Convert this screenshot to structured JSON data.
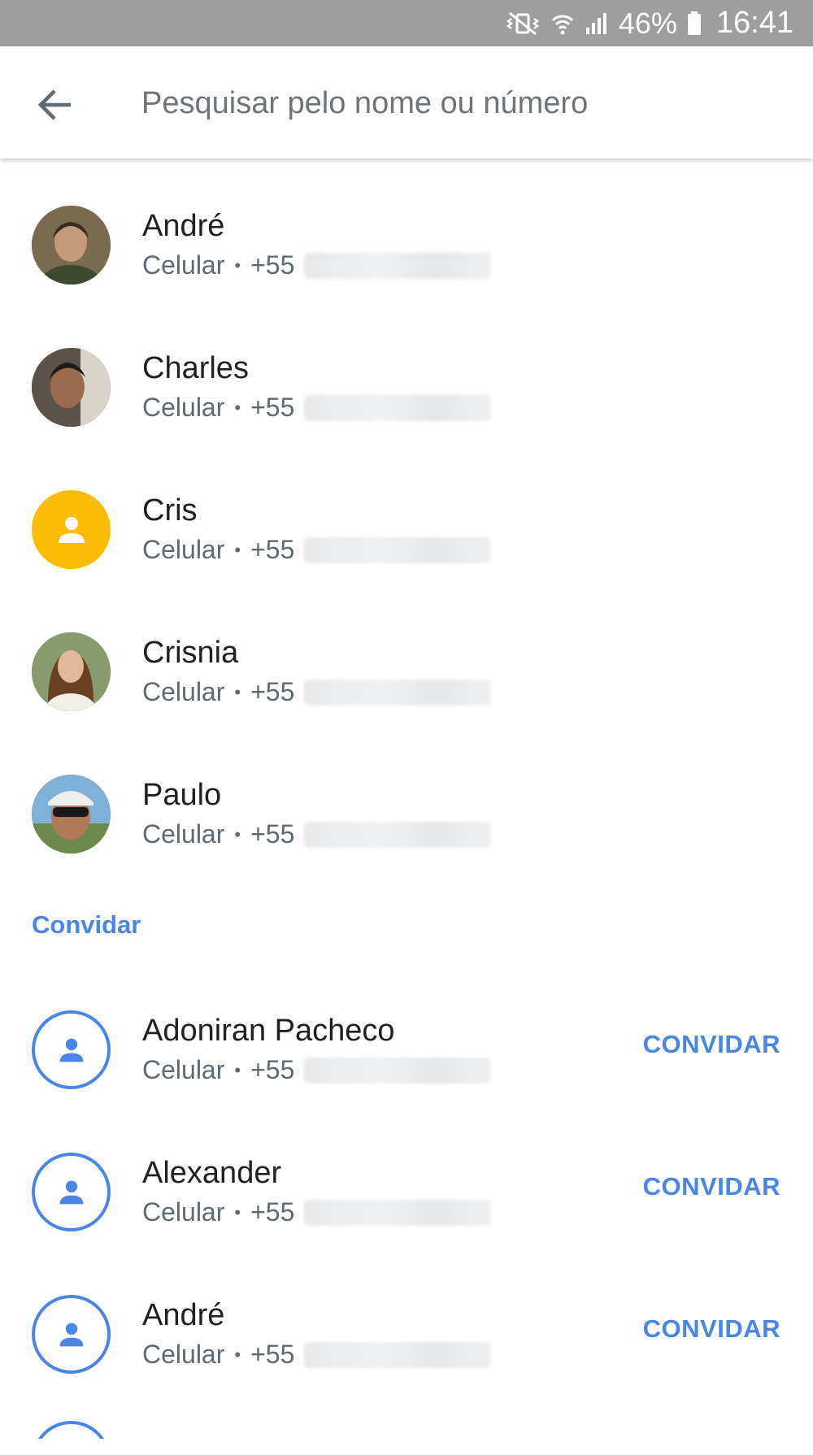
{
  "status_bar": {
    "battery_percent": "46%",
    "time": "16:41",
    "icons": [
      "vibrate-muted-icon",
      "wifi-icon",
      "signal-icon",
      "battery-icon"
    ]
  },
  "search": {
    "placeholder": "Pesquisar pelo nome ou número",
    "value": ""
  },
  "contacts": [
    {
      "name": "André",
      "type": "Celular",
      "country_code": "+55",
      "avatar": "photo"
    },
    {
      "name": "Charles",
      "type": "Celular",
      "country_code": "+55",
      "avatar": "photo"
    },
    {
      "name": "Cris",
      "type": "Celular",
      "country_code": "+55",
      "avatar": "person-icon"
    },
    {
      "name": "Crisnia",
      "type": "Celular",
      "country_code": "+55",
      "avatar": "photo"
    },
    {
      "name": "Paulo",
      "type": "Celular",
      "country_code": "+55",
      "avatar": "photo"
    }
  ],
  "invite_section": {
    "title": "Convidar",
    "button_label": "CONVIDAR",
    "contacts": [
      {
        "name": "Adoniran Pacheco",
        "type": "Celular",
        "country_code": "+55"
      },
      {
        "name": "Alexander",
        "type": "Celular",
        "country_code": "+55"
      },
      {
        "name": "André",
        "type": "Celular",
        "country_code": "+55"
      }
    ]
  },
  "colors": {
    "accent": "#4a86e8",
    "yellow_avatar": "#fbbc04",
    "status_bar": "#9e9e9e"
  }
}
